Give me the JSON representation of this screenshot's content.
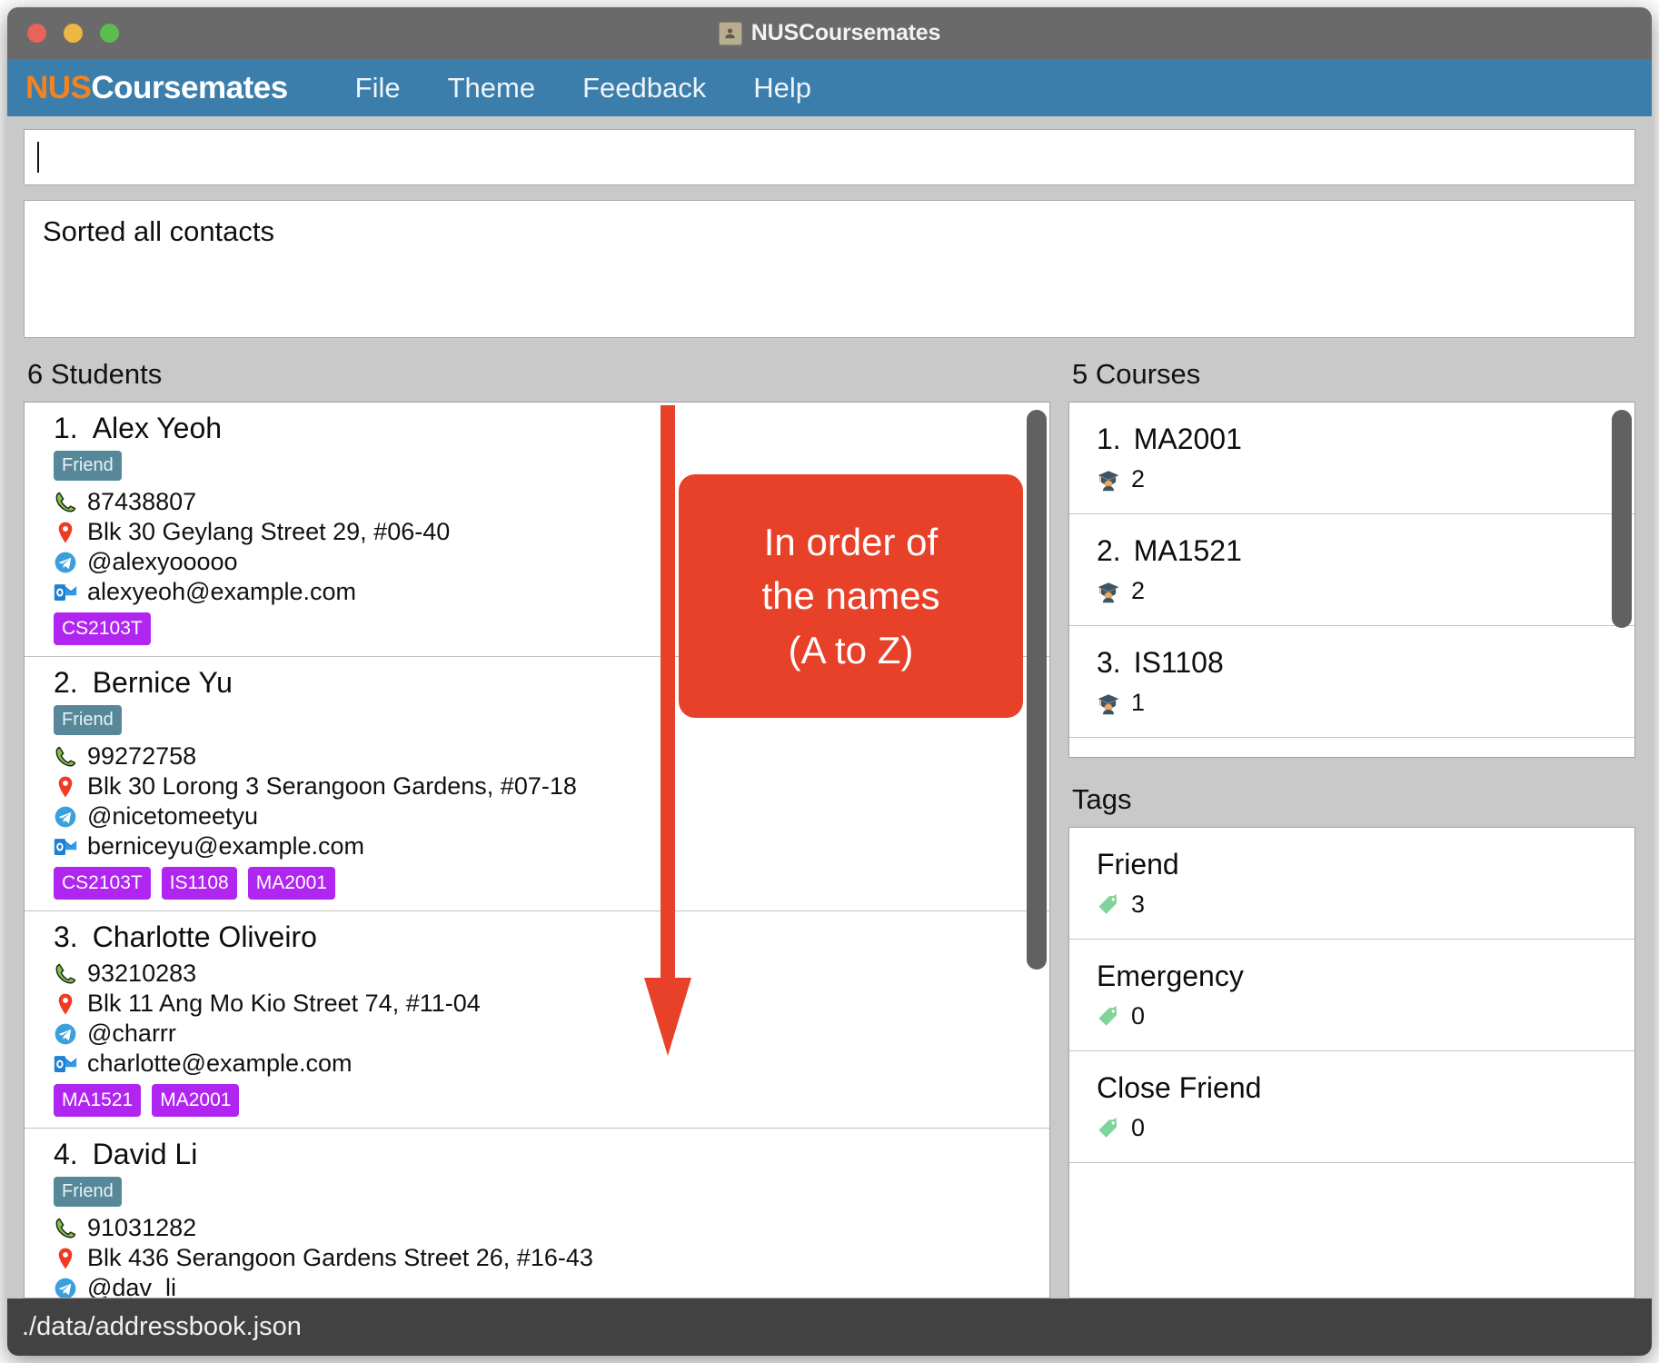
{
  "window": {
    "title": "NUSCoursemates",
    "app_icon": "contact-card-icon",
    "traffic_lights": [
      "close-button",
      "minimize-button",
      "maximize-button"
    ]
  },
  "menubar": {
    "brand_prefix": "NUS",
    "brand_suffix": "Coursemates",
    "items": [
      {
        "label": "File"
      },
      {
        "label": "Theme"
      },
      {
        "label": "Feedback"
      },
      {
        "label": "Help"
      }
    ]
  },
  "command": {
    "value": "",
    "placeholder": ""
  },
  "result": {
    "text": "Sorted all contacts"
  },
  "students_panel": {
    "heading": "6 Students",
    "students": [
      {
        "index": "1.",
        "name": "Alex Yeoh",
        "tags": [
          "Friend"
        ],
        "phone": "87438807",
        "address": "Blk 30 Geylang Street 29, #06-40",
        "telegram": "@alexyooooo",
        "email": "alexyeoh@example.com",
        "courses": [
          "CS2103T"
        ]
      },
      {
        "index": "2.",
        "name": "Bernice Yu",
        "tags": [
          "Friend"
        ],
        "phone": "99272758",
        "address": "Blk 30 Lorong 3 Serangoon Gardens, #07-18",
        "telegram": "@nicetomeetyu",
        "email": "berniceyu@example.com",
        "courses": [
          "CS2103T",
          "IS1108",
          "MA2001"
        ]
      },
      {
        "index": "3.",
        "name": "Charlotte Oliveiro",
        "tags": [],
        "phone": "93210283",
        "address": "Blk 11 Ang Mo Kio Street 74, #11-04",
        "telegram": "@charrr",
        "email": "charlotte@example.com",
        "courses": [
          "MA1521",
          "MA2001"
        ]
      },
      {
        "index": "4.",
        "name": "David Li",
        "tags": [
          "Friend"
        ],
        "phone": "91031282",
        "address": "Blk 436 Serangoon Gardens Street 26, #16-43",
        "telegram": "@dav_li",
        "email": "",
        "courses": []
      }
    ]
  },
  "courses_panel": {
    "heading": "5 Courses",
    "courses": [
      {
        "index": "1.",
        "code": "MA2001",
        "student_count": "2"
      },
      {
        "index": "2.",
        "code": "MA1521",
        "student_count": "2"
      },
      {
        "index": "3.",
        "code": "IS1108",
        "student_count": "1"
      }
    ]
  },
  "tags_panel": {
    "heading": "Tags",
    "tags": [
      {
        "name": "Friend",
        "count": "3"
      },
      {
        "name": "Emergency",
        "count": "0"
      },
      {
        "name": "Close Friend",
        "count": "0"
      }
    ]
  },
  "annotation": {
    "lines": [
      "In order of",
      "the names",
      "(A to Z)"
    ],
    "color": "#e8412a",
    "arrow": "down-arrow-annotation"
  },
  "statusbar": {
    "path": "./data/addressbook.json"
  },
  "colors": {
    "menubar_blue": "#3b7eab",
    "brand_orange": "#f4821f",
    "tag_chip_slate": "#56889a",
    "course_chip_purple": "#b026f0",
    "annotation_red": "#e8412a",
    "statusbar_dark": "#424242",
    "titlebar_grey": "#6a6a6a",
    "pane_background": "#c9c9c9"
  }
}
